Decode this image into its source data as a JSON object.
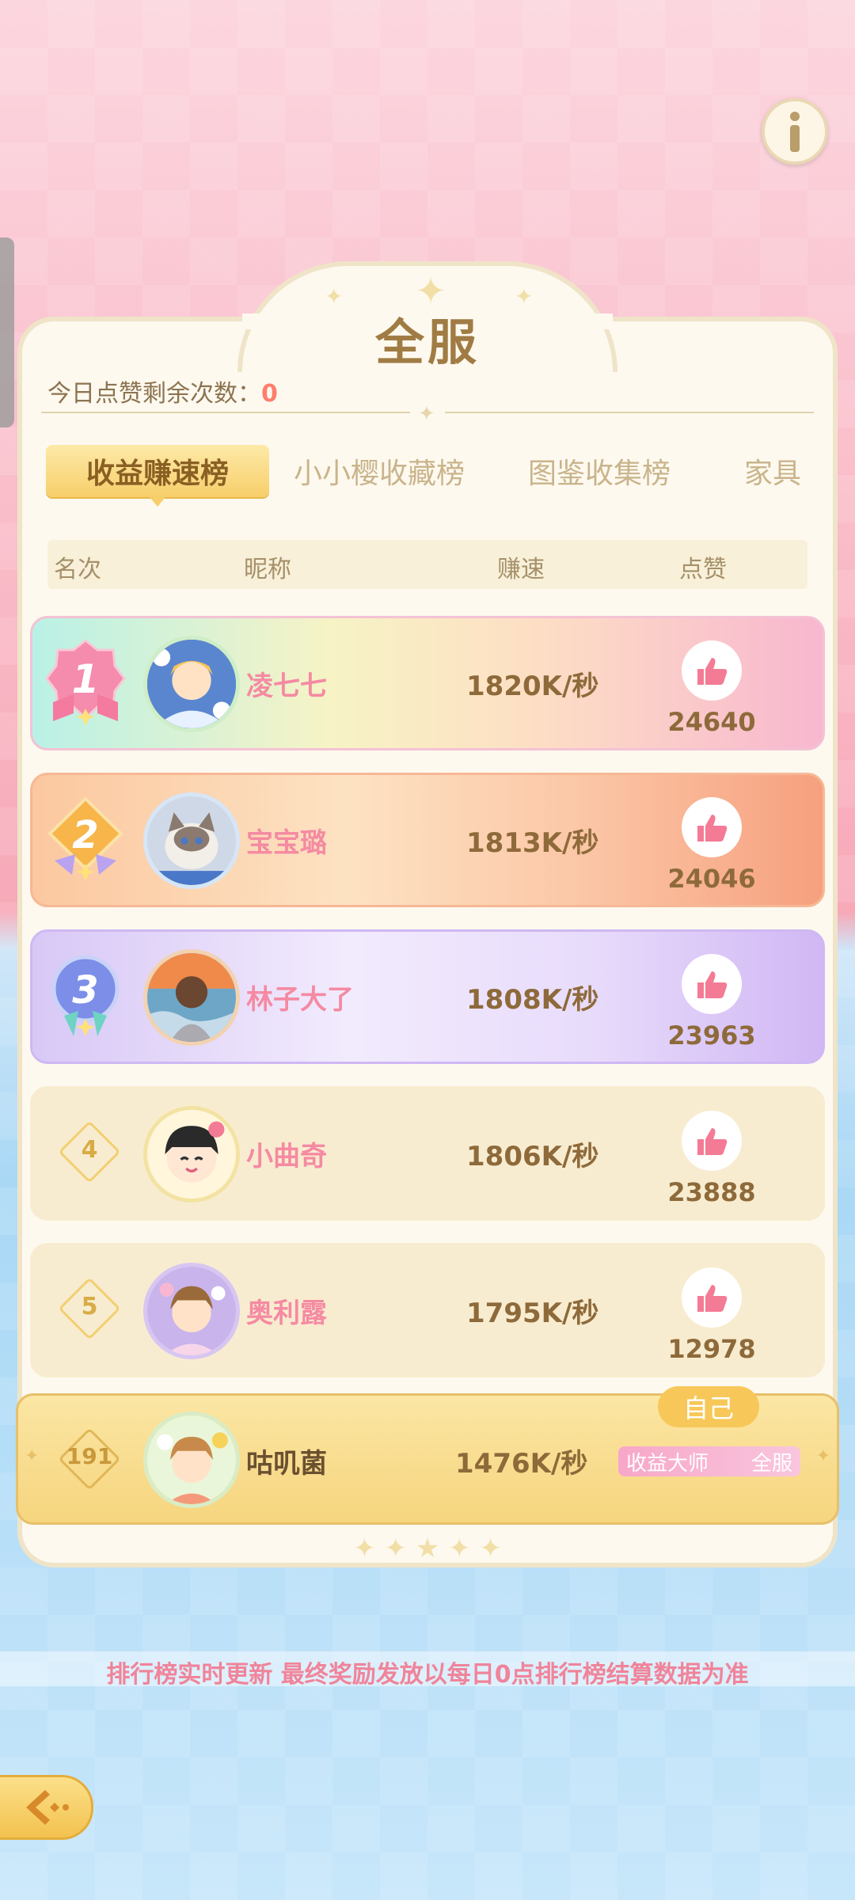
{
  "panel": {
    "title": "全服",
    "likes_remaining_label": "今日点赞剩余次数：",
    "likes_remaining_value": "0"
  },
  "tabs": [
    {
      "label": "收益赚速榜",
      "active": true
    },
    {
      "label": "小小樱收藏榜",
      "active": false
    },
    {
      "label": "图鉴收集榜",
      "active": false
    },
    {
      "label": "家具",
      "active": false
    }
  ],
  "columns": {
    "rank": "名次",
    "nickname": "昵称",
    "speed": "赚速",
    "likes": "点赞"
  },
  "rows": [
    {
      "rank": "1",
      "name": "凌七七",
      "speed": "1820K/秒",
      "likes": "24640"
    },
    {
      "rank": "2",
      "name": "宝宝璐",
      "speed": "1813K/秒",
      "likes": "24046"
    },
    {
      "rank": "3",
      "name": "林子大了",
      "speed": "1808K/秒",
      "likes": "23963"
    },
    {
      "rank": "4",
      "name": "小曲奇",
      "speed": "1806K/秒",
      "likes": "23888"
    },
    {
      "rank": "5",
      "name": "奥利露",
      "speed": "1795K/秒",
      "likes": "12978"
    }
  ],
  "self": {
    "tag": "自己",
    "rank": "191",
    "name": "咕叽菌",
    "speed": "1476K/秒",
    "title_left": "收益大师",
    "title_right": "全服"
  },
  "notice": "排行榜实时更新 最终奖励发放以每日0点排行榜结算数据为准",
  "icons": {
    "info": "info-icon",
    "like": "thumbs-up-icon",
    "back": "back-arrow-icon"
  },
  "colors": {
    "accent": "#a07c44",
    "like_pink": "#f47b95",
    "name_pink": "#f58aa2",
    "tab_active": "#f7cf6a"
  }
}
